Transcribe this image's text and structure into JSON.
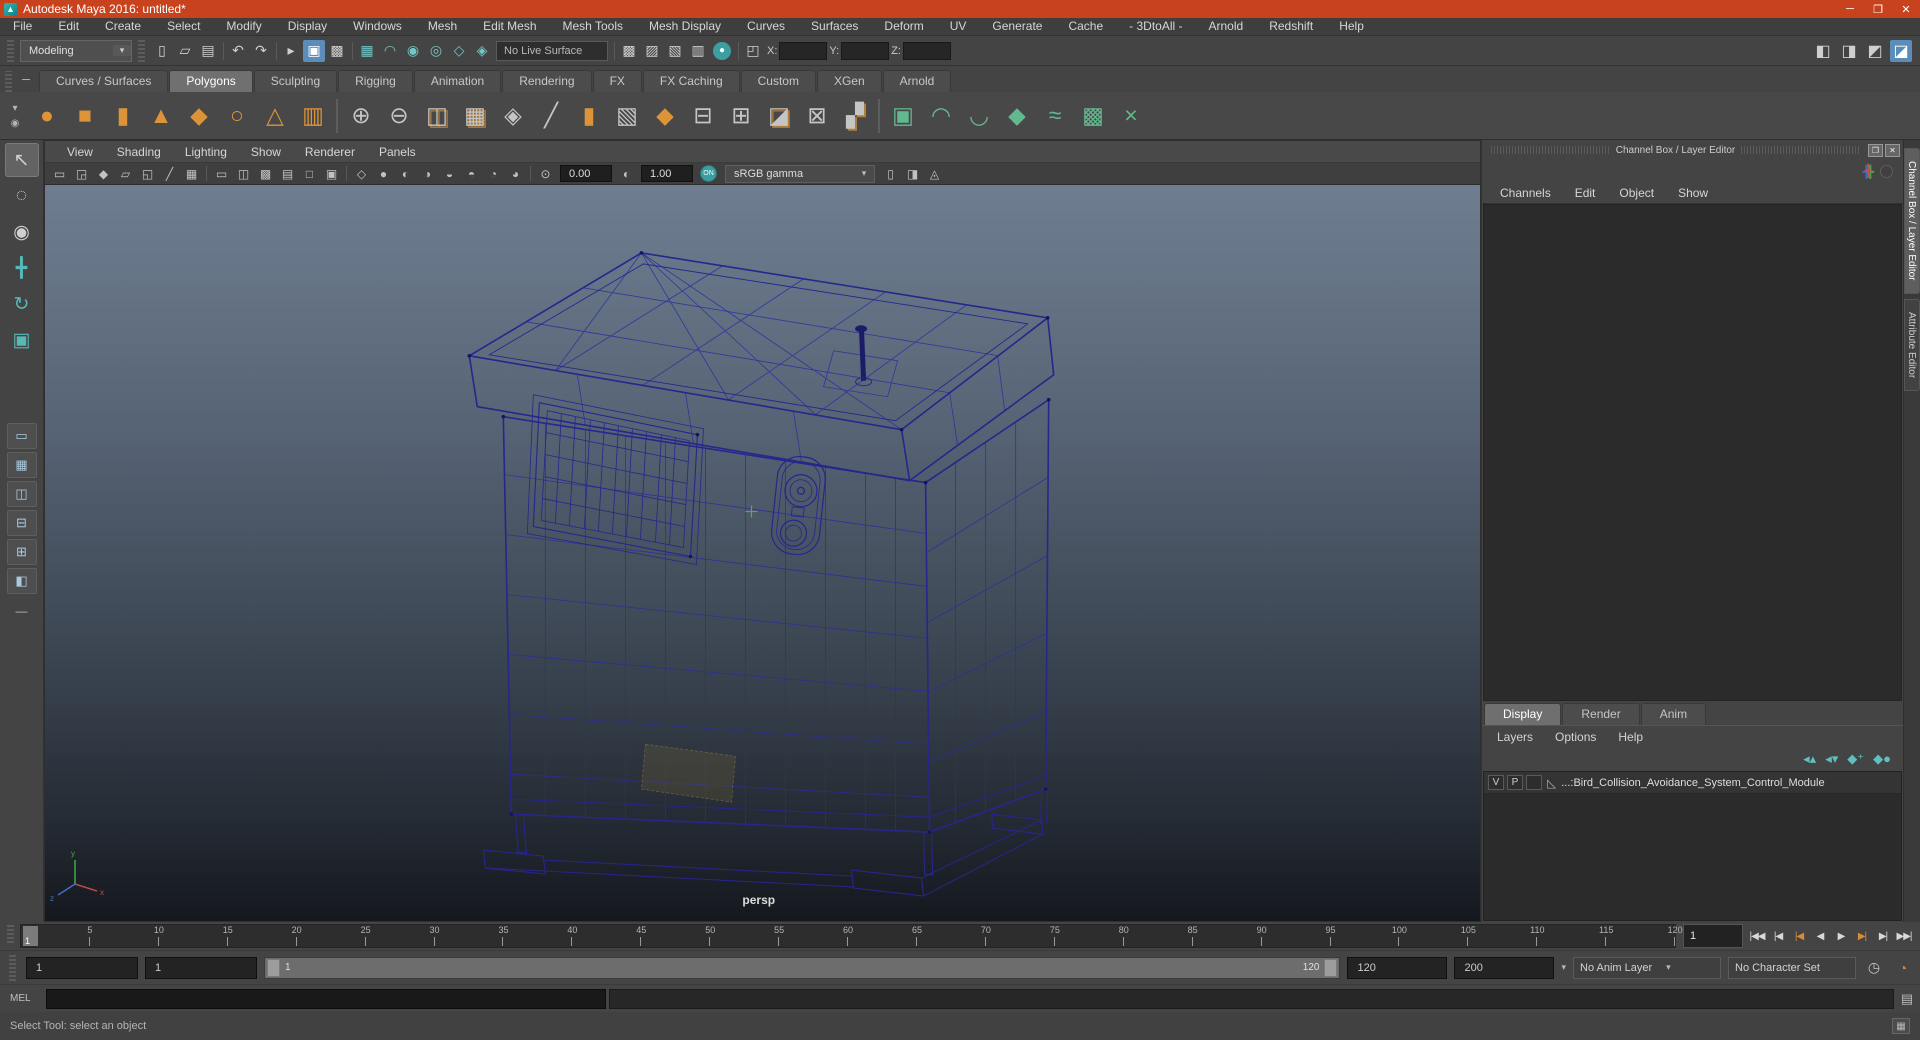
{
  "window": {
    "title": "Autodesk Maya 2016: untitled*",
    "minimize": "─",
    "maximize": "❐",
    "close": "✕",
    "logo_glyph": "▲"
  },
  "colors": {
    "titlebar": "#c8431d",
    "panel_bg": "#444444",
    "accent_teal": "#4fb5b5",
    "icon_orange": "#dd9438",
    "icon_green": "#63b98f",
    "selection_blue": "#5b8db8",
    "wireframe_navy": "#2b2ba0",
    "viewport_gradient_top": "#6e7e90",
    "viewport_gradient_bottom": "#14181e"
  },
  "menubar": {
    "items": [
      "File",
      "Edit",
      "Create",
      "Select",
      "Modify",
      "Display",
      "Windows",
      "Mesh",
      "Edit Mesh",
      "Mesh Tools",
      "Mesh Display",
      "Curves",
      "Surfaces",
      "Deform",
      "UV",
      "Generate",
      "Cache",
      "- 3DtoAll -",
      "Arnold",
      "Redshift",
      "Help"
    ]
  },
  "statusline": {
    "menuset": "Modeling",
    "menuset_arrow": "▾",
    "icons_left": [
      {
        "name": "new-scene-icon",
        "glyph": "▯",
        "type": "icon"
      },
      {
        "name": "open-scene-icon",
        "glyph": "▱",
        "type": "icon"
      },
      {
        "name": "save-scene-icon",
        "glyph": "▤",
        "type": "icon"
      },
      {
        "name": "separator",
        "glyph": "",
        "type": "sep"
      },
      {
        "name": "undo-icon",
        "glyph": "↶",
        "type": "icon"
      },
      {
        "name": "redo-icon",
        "glyph": "↷",
        "type": "icon"
      },
      {
        "name": "separator",
        "glyph": "",
        "type": "sep"
      },
      {
        "name": "select-hierarchy-icon",
        "glyph": "▸",
        "type": "icon"
      },
      {
        "name": "select-object-icon",
        "glyph": "▣",
        "type": "icon",
        "state": "active"
      },
      {
        "name": "select-component-icon",
        "glyph": "▩",
        "type": "icon"
      },
      {
        "name": "separator",
        "glyph": "",
        "type": "sep"
      },
      {
        "name": "snap-grid-icon",
        "glyph": "▦",
        "type": "icon",
        "tint": "teal"
      },
      {
        "name": "snap-curve-icon",
        "glyph": "◠",
        "type": "icon",
        "tint": "teal"
      },
      {
        "name": "snap-point-icon",
        "glyph": "◉",
        "type": "icon",
        "tint": "teal"
      },
      {
        "name": "snap-projected-center-icon",
        "glyph": "◎",
        "type": "icon",
        "tint": "teal"
      },
      {
        "name": "snap-view-plane-icon",
        "glyph": "◇",
        "type": "icon",
        "tint": "teal"
      },
      {
        "name": "make-live-icon",
        "glyph": "◈",
        "type": "icon",
        "tint": "teal"
      }
    ],
    "live_surface": "No Live Surface",
    "icons_right": [
      {
        "name": "separator",
        "glyph": "",
        "type": "sep"
      },
      {
        "name": "render-frame-icon",
        "glyph": "▩",
        "type": "icon"
      },
      {
        "name": "ipr-render-icon",
        "glyph": "▨",
        "type": "icon"
      },
      {
        "name": "render-settings-icon",
        "glyph": "▧",
        "type": "icon"
      },
      {
        "name": "render-sequence-icon",
        "glyph": "▥",
        "type": "icon"
      },
      {
        "name": "render-view-icon",
        "glyph": "●",
        "type": "icon",
        "tint": "teal-circle"
      },
      {
        "name": "separator",
        "glyph": "",
        "type": "sep"
      },
      {
        "name": "coords-input-type-icon",
        "glyph": "◰",
        "type": "icon"
      }
    ],
    "x_label": "X:",
    "y_label": "Y:",
    "z_label": "Z:",
    "sidebar_toggles": [
      {
        "name": "modeling-toolkit-toggle-icon",
        "glyph": "◧",
        "type": "icon"
      },
      {
        "name": "attribute-editor-toggle-icon",
        "glyph": "◨",
        "type": "icon"
      },
      {
        "name": "tool-settings-toggle-icon",
        "glyph": "◩",
        "type": "icon"
      },
      {
        "name": "channel-box-toggle-icon",
        "glyph": "◪",
        "type": "icon",
        "state": "active"
      }
    ]
  },
  "shelf": {
    "collapse_glyph": "─",
    "menu_arrow_glyph": "▾",
    "gear_glyph": "◉",
    "tabs": [
      {
        "name": "shelf-tab-curves-surfaces",
        "label": "Curves / Surfaces",
        "active": false
      },
      {
        "name": "shelf-tab-polygons",
        "label": "Polygons",
        "active": true
      },
      {
        "name": "shelf-tab-sculpting",
        "label": "Sculpting",
        "active": false
      },
      {
        "name": "shelf-tab-rigging",
        "label": "Rigging",
        "active": false
      },
      {
        "name": "shelf-tab-animation",
        "label": "Animation",
        "active": false
      },
      {
        "name": "shelf-tab-rendering",
        "label": "Rendering",
        "active": false
      },
      {
        "name": "shelf-tab-fx",
        "label": "FX",
        "active": false
      },
      {
        "name": "shelf-tab-fx-caching",
        "label": "FX Caching",
        "active": false
      },
      {
        "name": "shelf-tab-custom",
        "label": "Custom",
        "active": false
      },
      {
        "name": "shelf-tab-xgen",
        "label": "XGen",
        "active": false
      },
      {
        "name": "shelf-tab-arnold",
        "label": "Arnold",
        "active": false
      }
    ],
    "icons": [
      {
        "name": "poly-sphere-icon",
        "glyph": "●",
        "tint": "orange",
        "type": "icon"
      },
      {
        "name": "poly-cube-icon",
        "glyph": "■",
        "tint": "orange",
        "type": "icon"
      },
      {
        "name": "poly-cylinder-icon",
        "glyph": "▮",
        "tint": "orange",
        "type": "icon"
      },
      {
        "name": "poly-cone-icon",
        "glyph": "▲",
        "tint": "orange",
        "type": "icon"
      },
      {
        "name": "poly-plane-icon",
        "glyph": "◆",
        "tint": "orange",
        "type": "icon"
      },
      {
        "name": "poly-torus-icon",
        "glyph": "○",
        "tint": "orange",
        "type": "icon"
      },
      {
        "name": "poly-pyramid-icon",
        "glyph": "△",
        "tint": "orange",
        "type": "icon"
      },
      {
        "name": "poly-pipe-icon",
        "glyph": "▥",
        "tint": "orange",
        "type": "icon"
      },
      {
        "name": "separator",
        "glyph": "",
        "type": "sep"
      },
      {
        "name": "boolean-union-icon",
        "glyph": "⊕",
        "tint": "gray",
        "type": "icon"
      },
      {
        "name": "boolean-difference-icon",
        "glyph": "⊖",
        "tint": "gray",
        "type": "icon"
      },
      {
        "name": "combine-icon",
        "glyph": "◫",
        "tint": "mixed",
        "type": "icon"
      },
      {
        "name": "smooth-icon",
        "glyph": "▦",
        "tint": "mixed",
        "type": "icon"
      },
      {
        "name": "subdiv-proxy-icon",
        "glyph": "◈",
        "tint": "gray",
        "type": "icon"
      },
      {
        "name": "multi-cut-icon",
        "glyph": "╱",
        "tint": "gray",
        "type": "icon"
      },
      {
        "name": "extrude-icon",
        "glyph": "▮",
        "tint": "orange",
        "type": "icon"
      },
      {
        "name": "quad-patch-icon",
        "glyph": "▧",
        "tint": "gray",
        "type": "icon"
      },
      {
        "name": "bevel-icon",
        "glyph": "◆",
        "tint": "orange",
        "type": "icon"
      },
      {
        "name": "edge-loop-icon",
        "glyph": "⊟",
        "tint": "gray",
        "type": "icon"
      },
      {
        "name": "insert-edge-loop-icon",
        "glyph": "⊞",
        "tint": "gray",
        "type": "icon"
      },
      {
        "name": "fold-face-icon",
        "glyph": "◪",
        "tint": "mixed",
        "type": "icon"
      },
      {
        "name": "delete-edge-icon",
        "glyph": "⊠",
        "tint": "gray",
        "type": "icon"
      },
      {
        "name": "component-grid-icon",
        "glyph": "▞",
        "tint": "mixed",
        "type": "icon"
      },
      {
        "name": "separator",
        "glyph": "",
        "type": "sep"
      },
      {
        "name": "quad-draw-icon",
        "glyph": "▣",
        "tint": "green",
        "type": "icon"
      },
      {
        "name": "relax-brush-icon",
        "glyph": "◠",
        "tint": "green",
        "type": "icon"
      },
      {
        "name": "sculpt-brush-icon",
        "glyph": "◡",
        "tint": "green",
        "type": "icon"
      },
      {
        "name": "subdiv-cube-icon",
        "glyph": "◆",
        "tint": "green",
        "type": "icon"
      },
      {
        "name": "curve-warp-icon",
        "glyph": "≈",
        "tint": "green",
        "type": "icon"
      },
      {
        "name": "uv-editor-icon",
        "glyph": "▩",
        "tint": "green",
        "type": "icon"
      },
      {
        "name": "symmetry-icon",
        "glyph": "×",
        "tint": "green",
        "type": "icon"
      }
    ]
  },
  "toolbox": {
    "tools": [
      {
        "name": "select-tool",
        "glyph": "↖",
        "active": true
      },
      {
        "name": "lasso-select-tool",
        "glyph": "◌",
        "active": false
      },
      {
        "name": "paint-select-tool",
        "glyph": "◉",
        "active": false
      },
      {
        "name": "move-tool",
        "glyph": "╋",
        "active": false,
        "tint": "teal"
      },
      {
        "name": "rotate-tool",
        "glyph": "↻",
        "active": false,
        "tint": "teal"
      },
      {
        "name": "scale-tool",
        "glyph": "▣",
        "active": false,
        "tint": "teal"
      }
    ],
    "layouts": [
      {
        "name": "layout-single-pane",
        "glyph": "▭"
      },
      {
        "name": "layout-four-view",
        "glyph": "▦"
      },
      {
        "name": "layout-persp-outliner",
        "glyph": "◫"
      },
      {
        "name": "layout-persp-graph",
        "glyph": "⊟"
      },
      {
        "name": "layout-hypershade",
        "glyph": "⊞"
      },
      {
        "name": "layout-persp-uv",
        "glyph": "◧"
      }
    ],
    "dash": "—"
  },
  "viewport": {
    "menus": [
      "View",
      "Shading",
      "Lighting",
      "Show",
      "Renderer",
      "Panels"
    ],
    "toolbar_icons_a": [
      {
        "name": "select-camera-icon",
        "glyph": "▭",
        "type": "icon"
      },
      {
        "name": "camera-attributes-icon",
        "glyph": "◲",
        "type": "icon"
      },
      {
        "name": "bookmark-icon",
        "glyph": "◆",
        "type": "icon"
      },
      {
        "name": "image-plane-icon",
        "glyph": "▱",
        "type": "icon"
      },
      {
        "name": "two-d-pan-zoom-icon",
        "glyph": "◱",
        "type": "icon"
      },
      {
        "name": "grease-pencil-icon",
        "glyph": "╱",
        "type": "icon"
      },
      {
        "name": "grid-toggle-icon",
        "glyph": "▦",
        "type": "icon"
      },
      {
        "name": "separator",
        "glyph": "",
        "type": "sep"
      },
      {
        "name": "film-gate-icon",
        "glyph": "▭",
        "type": "icon"
      },
      {
        "name": "resolution-gate-icon",
        "glyph": "◫",
        "type": "icon"
      },
      {
        "name": "gate-mask-icon",
        "glyph": "▩",
        "type": "icon"
      },
      {
        "name": "field-chart-icon",
        "glyph": "▤",
        "type": "icon"
      },
      {
        "name": "safe-action-icon",
        "glyph": "□",
        "type": "icon"
      },
      {
        "name": "safe-title-icon",
        "glyph": "▣",
        "type": "icon"
      },
      {
        "name": "separator",
        "glyph": "",
        "type": "sep"
      },
      {
        "name": "wireframe-display-icon",
        "glyph": "◇",
        "type": "icon"
      },
      {
        "name": "smooth-shade-icon",
        "glyph": "●",
        "type": "icon"
      },
      {
        "name": "textured-display-icon",
        "glyph": "◐",
        "type": "icon"
      },
      {
        "name": "use-all-lights-icon",
        "glyph": "◑",
        "type": "icon"
      },
      {
        "name": "shadows-icon",
        "glyph": "◒",
        "type": "icon"
      },
      {
        "name": "ambient-occlusion-icon",
        "glyph": "◓",
        "type": "icon"
      },
      {
        "name": "motion-blur-icon",
        "glyph": "◔",
        "type": "icon"
      },
      {
        "name": "multisample-icon",
        "glyph": "◕",
        "type": "icon"
      },
      {
        "name": "separator",
        "glyph": "",
        "type": "sep"
      },
      {
        "name": "exposure-icon",
        "glyph": "⊙",
        "type": "icon"
      }
    ],
    "exposure": "0.00",
    "contrast_icon": "◐",
    "contrast": "1.00",
    "colorspace_toggle": "ON",
    "colorspace": "sRGB gamma",
    "colorspace_arrow": "▾",
    "toolbar_icons_b": [
      {
        "name": "isolate-select-icon",
        "glyph": "▯",
        "type": "icon"
      },
      {
        "name": "xray-icon",
        "glyph": "◨",
        "type": "icon"
      },
      {
        "name": "xray-joints-icon",
        "glyph": "◬",
        "type": "icon"
      }
    ],
    "camera_label": "persp",
    "axis_labels": {
      "x": "x",
      "y": "y",
      "z": "z"
    }
  },
  "channel_box": {
    "title": "Channel Box / Layer Editor",
    "float_glyph": "❐",
    "close_glyph": "✕",
    "tripod_glyph": "╋",
    "menus": [
      "Channels",
      "Edit",
      "Object",
      "Show"
    ],
    "side_tabs": [
      {
        "name": "side-tab-channel-box",
        "label": "Channel Box / Layer Editor",
        "active": true
      },
      {
        "name": "side-tab-attribute-editor",
        "label": "Attribute Editor",
        "active": false
      }
    ]
  },
  "layer_editor": {
    "tabs": [
      {
        "name": "layer-tab-display",
        "label": "Display",
        "active": true
      },
      {
        "name": "layer-tab-render",
        "label": "Render",
        "active": false
      },
      {
        "name": "layer-tab-anim",
        "label": "Anim",
        "active": false
      }
    ],
    "menus": [
      "Layers",
      "Options",
      "Help"
    ],
    "icons": [
      {
        "name": "layer-move-up-icon",
        "glyph": "◂▴"
      },
      {
        "name": "layer-move-down-icon",
        "glyph": "◂▾"
      },
      {
        "name": "layer-create-empty-icon",
        "glyph": "◆⁺"
      },
      {
        "name": "layer-create-from-selected-icon",
        "glyph": "◆●"
      }
    ],
    "layers": [
      {
        "visibility": "V",
        "playback": "P",
        "type_glyph": "◺",
        "layer_name": "...:Bird_Collision_Avoidance_System_Control_Module"
      }
    ]
  },
  "timeline": {
    "current_frame": "1",
    "ticks": [
      "5",
      "10",
      "15",
      "20",
      "25",
      "30",
      "35",
      "40",
      "45",
      "50",
      "55",
      "60",
      "65",
      "70",
      "75",
      "80",
      "85",
      "90",
      "95",
      "100",
      "105",
      "110",
      "115",
      "120"
    ],
    "frame_field": "1",
    "playback_buttons": [
      {
        "name": "go-to-start-button",
        "glyph": "|◀◀"
      },
      {
        "name": "step-back-frame-button",
        "glyph": "|◀"
      },
      {
        "name": "step-back-key-button",
        "glyph": "|◀",
        "tint": "orange"
      },
      {
        "name": "play-backwards-button",
        "glyph": "◀"
      },
      {
        "name": "play-forwards-button",
        "glyph": "▶"
      },
      {
        "name": "step-forward-key-button",
        "glyph": "▶|",
        "tint": "orange"
      },
      {
        "name": "step-forward-frame-button",
        "glyph": "▶|"
      },
      {
        "name": "go-to-end-button",
        "glyph": "▶▶|"
      }
    ]
  },
  "range_slider": {
    "anim_start": "1",
    "playback_start": "1",
    "range_start_label": "1",
    "range_end_label": "120",
    "playback_end": "120",
    "anim_end": "200",
    "dropdown_arrow": "▾",
    "anim_layer": "No Anim Layer",
    "character_set": "No Character Set",
    "autokey_glyph": "◷",
    "prefs_glyph": "◔"
  },
  "command_line": {
    "label": "MEL",
    "script_editor_glyph": "▤"
  },
  "help_line": {
    "text": "Select Tool: select an object",
    "corner_glyph": "▦"
  }
}
